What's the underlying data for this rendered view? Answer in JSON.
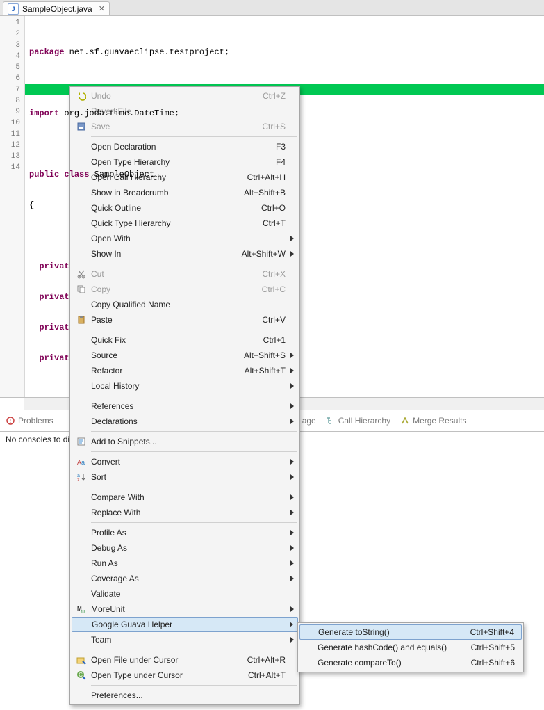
{
  "tab": {
    "label": "SampleObject.java",
    "icon_name": "java-file-icon",
    "close_glyph": "✕"
  },
  "gutter_lines": [
    "1",
    "2",
    "3",
    "4",
    "5",
    "6",
    "7",
    "8",
    "9",
    "10",
    "11",
    "12",
    "13",
    "14"
  ],
  "code": {
    "l1_kw": "package",
    "l1_rest": " net.sf.guavaeclipse.testproject;",
    "l3_kw": "import",
    "l3_rest": " org.joda.time.DateTime;",
    "l5_kw1": "public",
    "l5_kw2": " class",
    "l5_rest": " SampleObject",
    "l6": "{",
    "l8_kw": "  privat",
    "l8_rest": "",
    "l9_kw": "  privat",
    "l9_rest": "",
    "l10_kw": "  privat",
    "l10_rest": "",
    "l11_kw": "  privat",
    "l11_rest": "",
    "l13": "}"
  },
  "bottom_items": {
    "problems": "Problems",
    "coverage": "age",
    "call_hierarchy": "Call Hierarchy",
    "merge_results": "Merge Results"
  },
  "console_msg": "No consoles to dis",
  "menu": {
    "groups": [
      [
        {
          "label": "Undo",
          "shortcut": "Ctrl+Z",
          "disabled": true,
          "icon": "undo-icon"
        },
        {
          "label": "Revert File",
          "disabled": true
        },
        {
          "label": "Save",
          "shortcut": "Ctrl+S",
          "disabled": true,
          "icon": "save-icon"
        }
      ],
      [
        {
          "label": "Open Declaration",
          "shortcut": "F3"
        },
        {
          "label": "Open Type Hierarchy",
          "shortcut": "F4"
        },
        {
          "label": "Open Call Hierarchy",
          "shortcut": "Ctrl+Alt+H"
        },
        {
          "label": "Show in Breadcrumb",
          "shortcut": "Alt+Shift+B"
        },
        {
          "label": "Quick Outline",
          "shortcut": "Ctrl+O"
        },
        {
          "label": "Quick Type Hierarchy",
          "shortcut": "Ctrl+T"
        },
        {
          "label": "Open With",
          "submenu": true
        },
        {
          "label": "Show In",
          "shortcut": "Alt+Shift+W",
          "submenu": true
        }
      ],
      [
        {
          "label": "Cut",
          "shortcut": "Ctrl+X",
          "disabled": true,
          "icon": "cut-icon"
        },
        {
          "label": "Copy",
          "shortcut": "Ctrl+C",
          "disabled": true,
          "icon": "copy-icon"
        },
        {
          "label": "Copy Qualified Name"
        },
        {
          "label": "Paste",
          "shortcut": "Ctrl+V",
          "icon": "paste-icon"
        }
      ],
      [
        {
          "label": "Quick Fix",
          "shortcut": "Ctrl+1"
        },
        {
          "label": "Source",
          "shortcut": "Alt+Shift+S",
          "submenu": true
        },
        {
          "label": "Refactor",
          "shortcut": "Alt+Shift+T",
          "submenu": true
        },
        {
          "label": "Local History",
          "submenu": true
        }
      ],
      [
        {
          "label": "References",
          "submenu": true
        },
        {
          "label": "Declarations",
          "submenu": true
        }
      ],
      [
        {
          "label": "Add to Snippets...",
          "icon": "snippet-icon"
        }
      ],
      [
        {
          "label": "Convert",
          "submenu": true,
          "icon": "convert-icon"
        },
        {
          "label": "Sort",
          "submenu": true,
          "icon": "sort-icon"
        }
      ],
      [
        {
          "label": "Compare With",
          "submenu": true
        },
        {
          "label": "Replace With",
          "submenu": true
        }
      ],
      [
        {
          "label": "Profile As",
          "submenu": true
        },
        {
          "label": "Debug As",
          "submenu": true
        },
        {
          "label": "Run As",
          "submenu": true
        },
        {
          "label": "Coverage As",
          "submenu": true
        },
        {
          "label": "Validate"
        },
        {
          "label": "MoreUnit",
          "submenu": true,
          "icon": "moreunit-icon"
        },
        {
          "label": "Google Guava Helper",
          "submenu": true,
          "hover": true
        },
        {
          "label": "Team",
          "submenu": true
        }
      ],
      [
        {
          "label": "Open File under Cursor",
          "shortcut": "Ctrl+Alt+R",
          "icon": "open-file-cursor-icon"
        },
        {
          "label": "Open Type under Cursor",
          "shortcut": "Ctrl+Alt+T",
          "icon": "open-type-cursor-icon"
        }
      ],
      [
        {
          "label": "Preferences..."
        }
      ]
    ]
  },
  "submenu": {
    "items": [
      {
        "label": "Generate toString()",
        "shortcut": "Ctrl+Shift+4",
        "hover": true
      },
      {
        "label": "Generate hashCode() and equals()",
        "shortcut": "Ctrl+Shift+5"
      },
      {
        "label": "Generate compareTo()",
        "shortcut": "Ctrl+Shift+6"
      }
    ]
  }
}
